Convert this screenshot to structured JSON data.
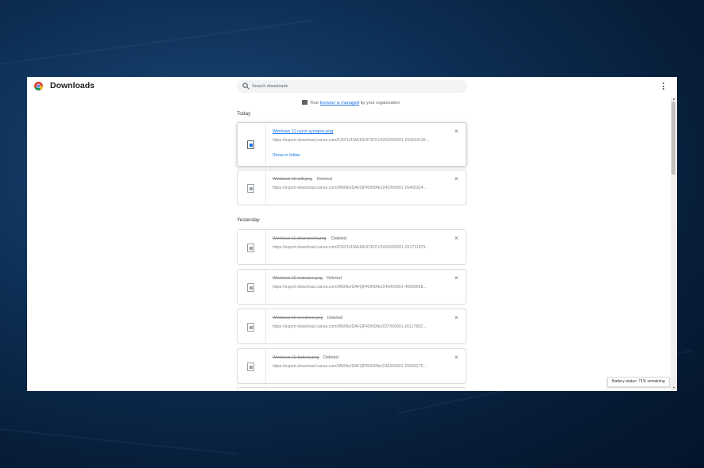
{
  "app": {
    "title": "Downloads"
  },
  "search": {
    "placeholder": "Search downloads"
  },
  "managed": {
    "prefix": "Your",
    "link": "browser is managed",
    "suffix": "by your organization"
  },
  "sections": {
    "today": "Today",
    "yesterday": "Yesterday"
  },
  "downloads": [
    {
      "name": "Windows 11 razor synapse.png",
      "status": "",
      "url": "https://export-download.canva.com/F397U/DAE69UF397U/1052/0/0001-269164135...",
      "action": "Show in folder"
    },
    {
      "name": "Windows 10 wifi.png",
      "status": "Deleted",
      "url": "https://export-download.canva.com/9N0No/DAFQPR9N0No/242/0/0001-26465324..."
    },
    {
      "name": "Windows 11 sharepoint.png",
      "status": "Deleted",
      "url": "https://export-download.canva.com/F397U/DAE69UF397U/1050/0/0001-261711979..."
    },
    {
      "name": "Windows 10 malware.png",
      "status": "Deleted",
      "url": "https://export-download.canva.com/9N0No/DAFQPR9N0No/240/0/0001-45899658..."
    },
    {
      "name": "Windows 10 onedrive.png",
      "status": "Deleted",
      "url": "https://export-download.canva.com/9N0No/DAFQPR9N0No/237/0/0001-26117892..."
    },
    {
      "name": "Windows 10 battery.png",
      "status": "Deleted",
      "url": "https://export-download.canva.com/9N0No/DAFQPR9N0No/236/0/0001-25835275..."
    }
  ],
  "tooltip": {
    "battery": "Battery status: 71% remaining"
  },
  "icons": {
    "close": "close-icon",
    "more": "more-vert-icon",
    "search": "search-icon",
    "file": "file-icon",
    "chrome": "chrome-logo"
  },
  "colors": {
    "link": "#1a73e8",
    "text": "#202124",
    "muted": "#80868b"
  }
}
